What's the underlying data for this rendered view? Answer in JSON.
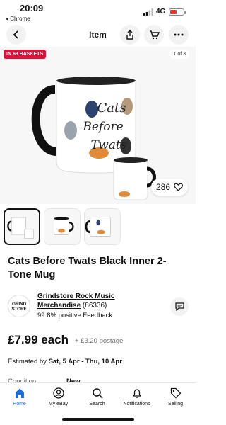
{
  "status": {
    "time": "20:09",
    "back_app": "◂ Chrome",
    "network": "4G"
  },
  "nav": {
    "title": "Item"
  },
  "hero": {
    "badge": "IN 63 BASKETS",
    "counter": "1 of 3",
    "mug_text": [
      "Cats",
      "Before",
      "Twats"
    ],
    "watch_count": "286"
  },
  "product": {
    "title": "Cats Before Twats Black Inner 2-Tone Mug",
    "seller_logo": "GRIND STORE",
    "seller_name": "Grindstore Rock Music Merchandise",
    "seller_count": "(86336)",
    "feedback": "99.8% positive Feedback",
    "price": "£7.99 each",
    "postage": "+ £3.20 postage",
    "est_prefix": "Estimated by ",
    "est_dates": "Sat, 5 Apr - Thu, 10 Apr",
    "condition_label": "Condition",
    "condition_value": "New"
  },
  "tabs": [
    {
      "label": "Home",
      "icon": "home-icon"
    },
    {
      "label": "My eBay",
      "icon": "person-icon"
    },
    {
      "label": "Search",
      "icon": "search-icon"
    },
    {
      "label": "Notifications",
      "icon": "bell-icon"
    },
    {
      "label": "Selling",
      "icon": "tag-icon"
    }
  ],
  "colors": {
    "accent": "#1a6ce0",
    "badge": "#e0103a"
  }
}
